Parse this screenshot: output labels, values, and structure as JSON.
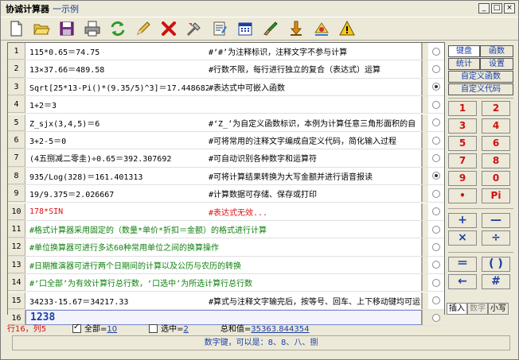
{
  "window": {
    "title": "协诚计算器",
    "subtitle": "一示例",
    "controls": [
      "_",
      "□",
      "×"
    ]
  },
  "toolbar": [
    {
      "name": "new-file-icon"
    },
    {
      "name": "open-folder-icon"
    },
    {
      "name": "save-icon"
    },
    {
      "name": "print-icon"
    },
    {
      "name": "refresh-icon"
    },
    {
      "name": "edit-pencil-icon"
    },
    {
      "name": "delete-icon"
    },
    {
      "name": "tools-icon"
    },
    {
      "name": "notes-icon"
    },
    {
      "name": "calendar-icon"
    },
    {
      "name": "brush-icon"
    },
    {
      "name": "download-arrow-icon"
    },
    {
      "name": "convert-icon"
    },
    {
      "name": "warning-icon"
    }
  ],
  "rows": [
    {
      "num": "1",
      "expr": "115*0.65＝74.75",
      "comment": "#‘#’为注释标识，注释文字不参与计算",
      "color": "black",
      "checked": false
    },
    {
      "num": "2",
      "expr": "13×37.66＝489.58",
      "comment": "#行数不限，每行进行独立的复合（表达式）运算",
      "color": "black",
      "checked": false
    },
    {
      "num": "3",
      "expr": "Sqrt[25*13-Pi()*(9.35/5)^3]＝17.448682",
      "comment": "#表达式中可嵌入函数",
      "color": "black",
      "checked": true
    },
    {
      "num": "4",
      "expr": "1+2＝3",
      "comment": "",
      "color": "black",
      "checked": false
    },
    {
      "num": "5",
      "expr": "Z_sjx(3,4,5)＝6",
      "comment": "#‘Z_’为自定义函数标识，本例为计算任意三角形面积的自",
      "color": "black",
      "checked": false
    },
    {
      "num": "6",
      "expr": "3+2-5＝0",
      "comment": "#可将常用的注释文字编成自定义代码，简化输入过程",
      "color": "black",
      "checked": false
    },
    {
      "num": "7",
      "expr": "(4五捌减二零圭)÷0.65＝392.307692",
      "comment": "#可自动识别各种数字和运算符",
      "color": "black",
      "checked": false
    },
    {
      "num": "8",
      "expr": "935/Log(328)＝161.401313",
      "comment": "#可将计算结果转换为大写金额并进行语音报读",
      "color": "black",
      "checked": true
    },
    {
      "num": "9",
      "expr": "19/9.375＝2.026667",
      "comment": "#计算数据可存储、保存或打印",
      "color": "black",
      "checked": false
    },
    {
      "num": "10",
      "expr": "178*SIN",
      "comment": "#表达式无效...",
      "color": "red",
      "checked": false
    },
    {
      "num": "11",
      "expr": "#格式计算器采用固定的（数量*单价*折扣＝金额）的格式进行计算",
      "comment": "",
      "color": "green",
      "checked": false
    },
    {
      "num": "12",
      "expr": "#单位换算器可进行多达60种常用单位之间的换算操作",
      "comment": "",
      "color": "green",
      "checked": false
    },
    {
      "num": "13",
      "expr": "#日期推演器可进行两个日期间的计算以及公历与农历的转换",
      "comment": "",
      "color": "green",
      "checked": false
    },
    {
      "num": "14",
      "expr": "#‘口全部’为有效计算行总行数，‘口选中’为所选计算行总行数",
      "comment": "",
      "color": "green",
      "checked": false
    },
    {
      "num": "15",
      "expr": "34233-15.67＝34217.33",
      "comment": "#算式与注释文字输完后，按等号、回车、上下移动键均可运",
      "color": "black",
      "checked": false
    }
  ],
  "input_row": {
    "num": "16",
    "value": "1238"
  },
  "side": {
    "tabs": [
      "键盘",
      "函数",
      "统计",
      "设置",
      "自定义函数",
      "自定义代码"
    ],
    "digits": [
      "1",
      "2",
      "3",
      "4",
      "5",
      "6",
      "7",
      "8",
      "9",
      "0",
      "•",
      "Pi"
    ],
    "ops": [
      "+",
      "—",
      "×",
      "÷"
    ],
    "ops2": [
      "＝",
      "( )",
      "←",
      "#"
    ],
    "bottom_tabs": [
      "插入",
      "数字",
      "小写"
    ]
  },
  "status": {
    "position": "行16，列5",
    "all_label": "全部=",
    "all_value": "10",
    "all_checked": true,
    "selected_label": "选中=",
    "selected_value": "2",
    "selected_checked": false,
    "sum_label": "总和值=",
    "sum_value": "35363.844354",
    "bar_text": "数字键，可以是：8、8、八、捌"
  }
}
